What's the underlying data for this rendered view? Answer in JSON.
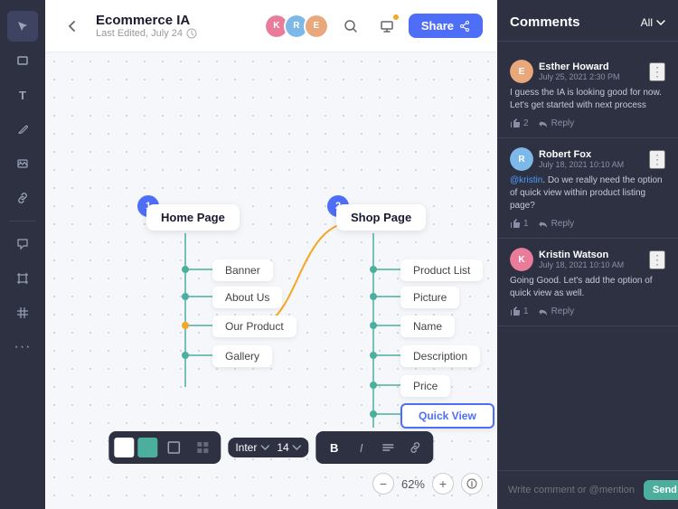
{
  "app": {
    "title": "Ecommerce IA",
    "subtitle": "Last Edited, July 24",
    "back_label": "←",
    "share_label": "Share"
  },
  "toolbar": {
    "tools": [
      {
        "name": "select",
        "icon": "▲",
        "active": true
      },
      {
        "name": "rectangle",
        "icon": "▭"
      },
      {
        "name": "text",
        "icon": "T"
      },
      {
        "name": "pen",
        "icon": "/"
      },
      {
        "name": "image",
        "icon": "🖼"
      },
      {
        "name": "link",
        "icon": "🔗"
      },
      {
        "name": "speech",
        "icon": "💬"
      },
      {
        "name": "frame",
        "icon": "⊡"
      },
      {
        "name": "grid",
        "icon": "#"
      },
      {
        "name": "more",
        "icon": "···"
      }
    ]
  },
  "diagram": {
    "pages": [
      {
        "id": 1,
        "badge": "1",
        "title": "Home Page",
        "children": [
          "Banner",
          "About Us",
          "Our Product",
          "Gallery"
        ]
      },
      {
        "id": 2,
        "badge": "2",
        "title": "Shop Page",
        "children": [
          "Product List",
          "Picture",
          "Name",
          "Description",
          "Price",
          "Quick View"
        ]
      }
    ]
  },
  "bottom_toolbar": {
    "fill_colors": [
      "white",
      "green",
      "outline",
      "grid"
    ],
    "font_family": "Inter",
    "font_size": "14",
    "text_actions": [
      "B",
      "I",
      "≡",
      "🔗"
    ]
  },
  "zoom": {
    "minus": "−",
    "percent": "62%",
    "plus": "+",
    "info": "ℹ"
  },
  "comments": {
    "title": "Comments",
    "filter": "All",
    "items": [
      {
        "id": 1,
        "user": "Esther Howard",
        "date": "July 25, 2021 2:30 PM",
        "text": "I guess the IA is looking good for now. Let's get started with next process",
        "likes": 2,
        "avatar_color": "#e8a87c"
      },
      {
        "id": 2,
        "user": "Robert Fox",
        "date": "July 18, 2021 10:10 AM",
        "text": "@kristin. Do we really need the option of quick view within product listing page?",
        "likes": 1,
        "avatar_color": "#7cb8e8"
      },
      {
        "id": 3,
        "user": "Kristin Watson",
        "date": "July 18, 2021 10:10 AM",
        "text": "Going Good. Let's add the option of quick view as well.",
        "likes": 1,
        "avatar_color": "#e87c9a"
      }
    ],
    "input_placeholder": "Write comment or @mention",
    "send_label": "Send"
  }
}
